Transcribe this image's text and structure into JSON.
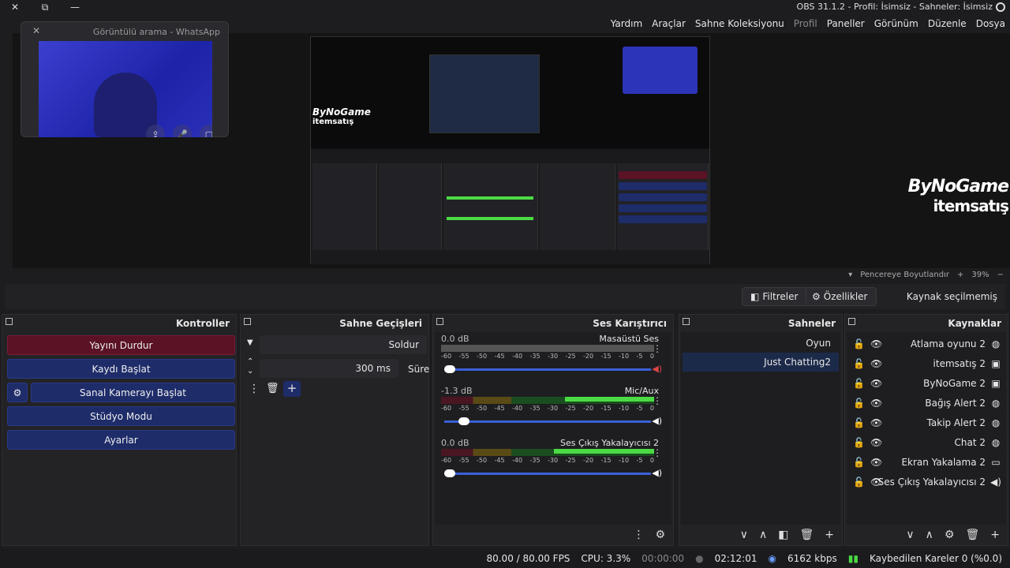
{
  "window": {
    "title": "OBS 31.1.2 - Profil: İsimsiz - Sahneler: İsimsiz",
    "close": "✕",
    "maximize": "⧉",
    "minimize": "—"
  },
  "menu": [
    "Dosya",
    "Düzenle",
    "Görünüm",
    "Paneller",
    "Profil",
    "Sahne Koleksiyonu",
    "Araçlar",
    "Yardım"
  ],
  "whatsapp": {
    "title": "Görüntülü arama - WhatsApp"
  },
  "brand": {
    "line1": "ByNoGame",
    "line2": "itemsatış"
  },
  "inner_brand": {
    "line1": "ByNoGame",
    "line2": "itemsatış"
  },
  "zoom": {
    "label": "Pencereye Boyutlandır",
    "value": "39%",
    "plus": "+",
    "minus": "−"
  },
  "source_bar": {
    "label": "Kaynak seçilmemiş",
    "properties": "Özellikler",
    "filters": "Filtreler"
  },
  "docks": {
    "sources": "Kaynaklar",
    "scenes": "Sahneler",
    "mixer": "Ses Karıştırıcı",
    "transitions": "Sahne Geçişleri",
    "controls": "Kontroller"
  },
  "sources": [
    {
      "name": "Atlama oyunu 2",
      "icon": "globe-icon"
    },
    {
      "name": "itemsatış 2",
      "icon": "image-icon"
    },
    {
      "name": "ByNoGame 2",
      "icon": "image-icon"
    },
    {
      "name": "Bağış Alert 2",
      "icon": "globe-icon"
    },
    {
      "name": "Takip Alert 2",
      "icon": "globe-icon"
    },
    {
      "name": "Chat 2",
      "icon": "globe-icon"
    },
    {
      "name": "Ekran Yakalama 2",
      "icon": "monitor-icon"
    },
    {
      "name": "Ses Çıkış Yakalayıcısı 2",
      "icon": "speaker-icon"
    }
  ],
  "scenes": [
    {
      "name": "Oyun",
      "selected": false
    },
    {
      "name": "Just Chatting2",
      "selected": true
    }
  ],
  "mixer": [
    {
      "name": "Masaüstü Ses",
      "db": "0.0 dB",
      "level": 0.0,
      "volume": 1.0,
      "muted": true
    },
    {
      "name": "Mic/Aux",
      "db": "-1.3 dB",
      "level": 0.42,
      "volume": 0.93,
      "muted": false
    },
    {
      "name": "Ses Çıkış Yakalayıcısı 2",
      "db": "0.0 dB",
      "level": 0.47,
      "volume": 1.0,
      "muted": false
    }
  ],
  "ticks": [
    "-60",
    "-55",
    "-50",
    "-45",
    "-40",
    "-35",
    "-30",
    "-25",
    "-20",
    "-15",
    "-10",
    "-5",
    "0"
  ],
  "transitions": {
    "type": "Soldur",
    "duration_label": "Süre",
    "duration": "300 ms"
  },
  "controls": {
    "stop_stream": "Yayını Durdur",
    "start_record": "Kaydı Başlat",
    "virtual_cam": "Sanal Kamerayı Başlat",
    "studio_mode": "Stüdyo Modu",
    "settings": "Ayarlar"
  },
  "status": {
    "dropped": "Kaybedilen Kareler 0 (%0.0)",
    "bitrate": "6162 kbps",
    "stream_time": "02:12:01",
    "record_time": "00:00:00",
    "cpu": "CPU: 3.3%",
    "fps": "80.00 / 80.00 FPS"
  },
  "colors": {
    "accent": "#3b5fd6",
    "stop_button": "#5a1224",
    "button": "#1e2c6a",
    "meter_green": "#4cdb44"
  }
}
